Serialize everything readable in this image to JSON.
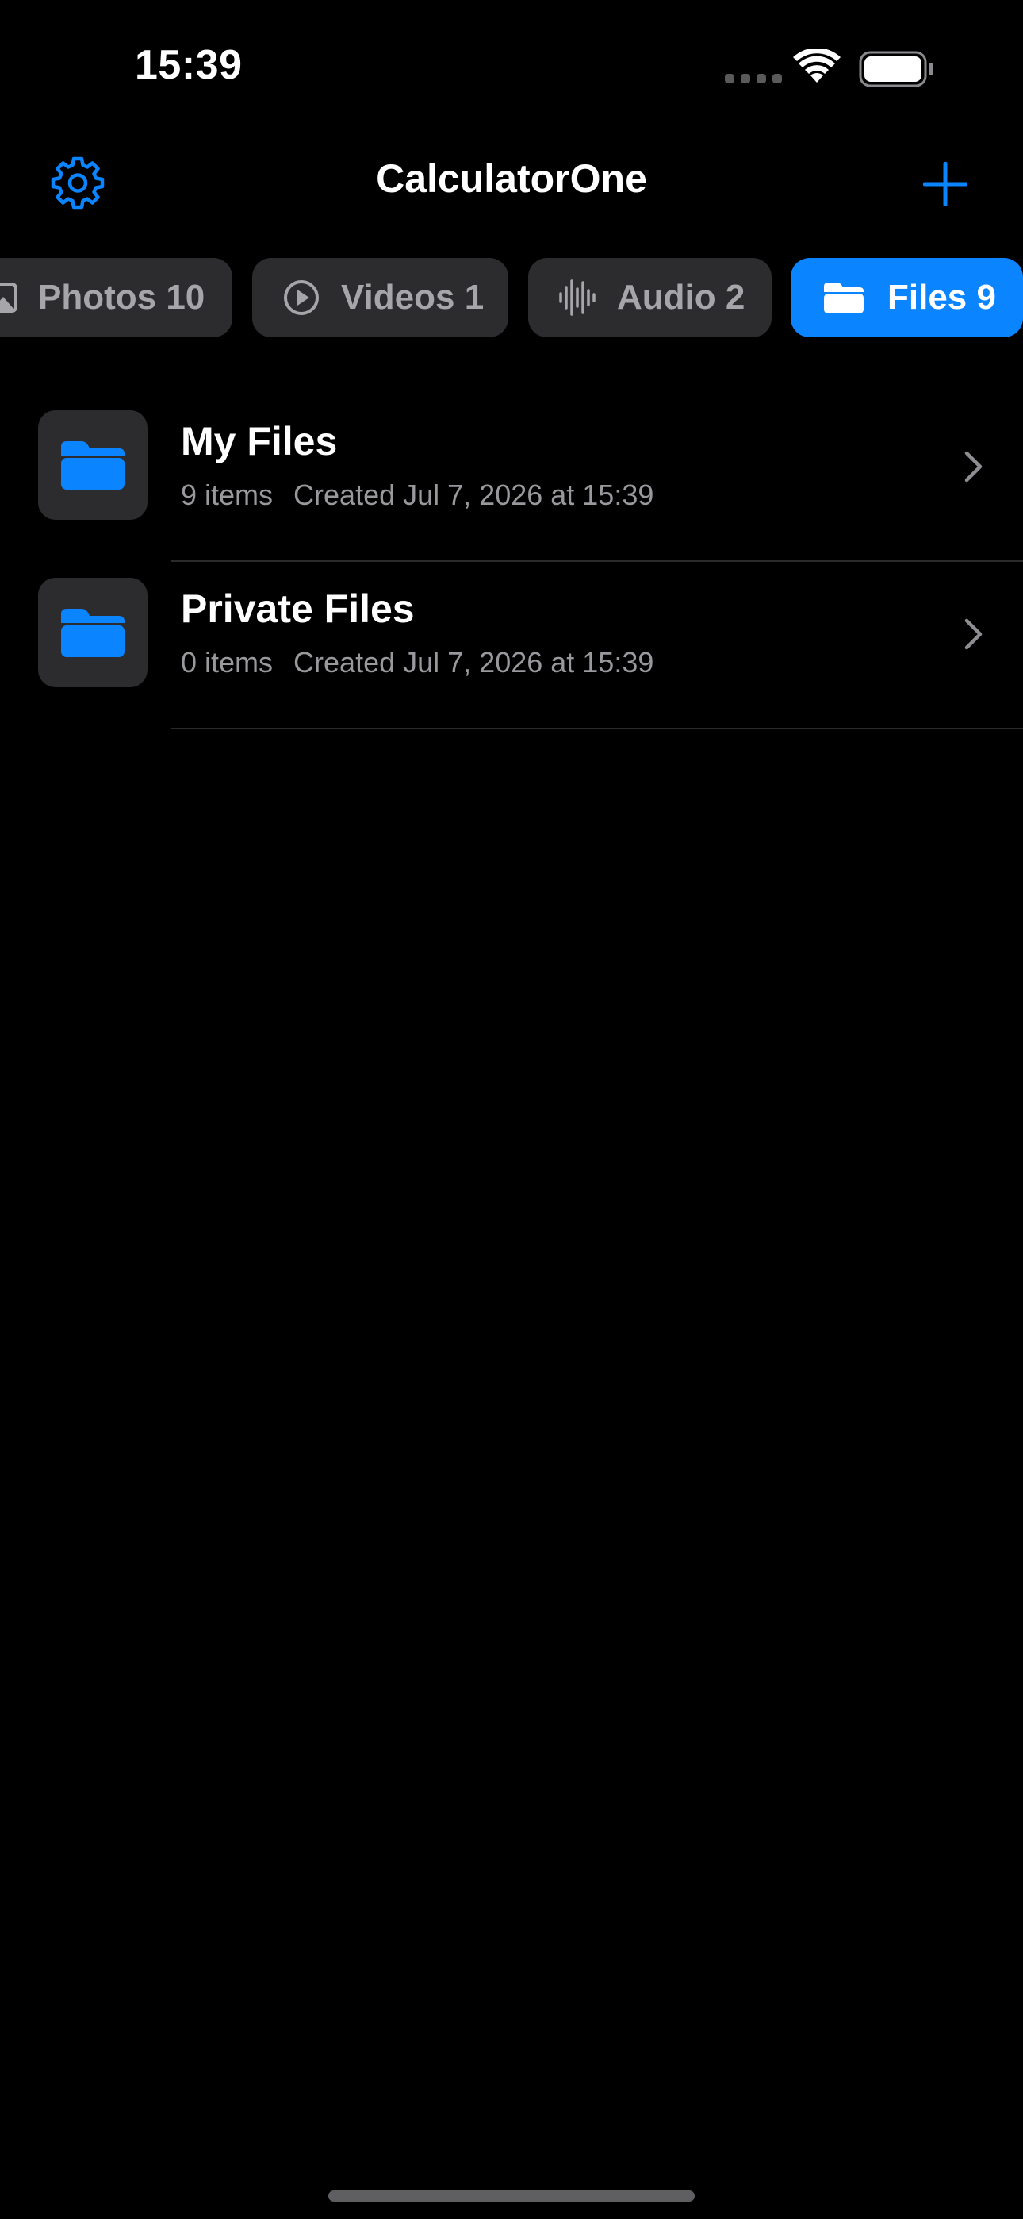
{
  "status_bar": {
    "time": "15:39"
  },
  "nav": {
    "title": "CalculatorOne",
    "settings_icon": "gear-icon",
    "add_icon": "plus-icon",
    "accent_color": "#0a84ff"
  },
  "tabs": [
    {
      "label": "Photos 10",
      "icon": "photo-icon",
      "selected": false
    },
    {
      "label": "Videos 1",
      "icon": "play-circle-icon",
      "selected": false
    },
    {
      "label": "Audio 2",
      "icon": "waveform-icon",
      "selected": false
    },
    {
      "label": "Files 9",
      "icon": "folder-icon",
      "selected": true
    }
  ],
  "folders": [
    {
      "name": "My Files",
      "count": "9 items",
      "created": "Created Jul 7, 2026 at 15:39"
    },
    {
      "name": "Private Files",
      "count": "0 items",
      "created": "Created Jul 7, 2026 at 15:39"
    }
  ]
}
